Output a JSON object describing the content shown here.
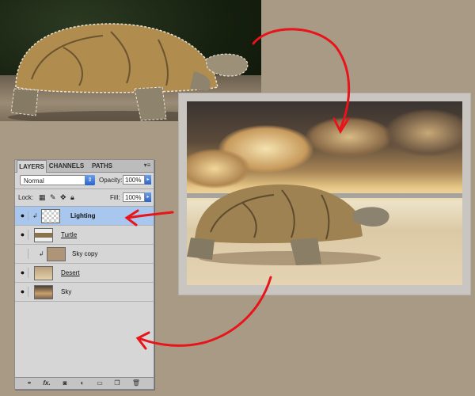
{
  "panel": {
    "tabs": [
      {
        "label": "LAYERS",
        "active": true
      },
      {
        "label": "CHANNELS",
        "active": false
      },
      {
        "label": "PATHS",
        "active": false
      }
    ],
    "menu_icon": "panel-menu-icon",
    "blend_mode": "Normal",
    "opacity_label": "Opacity:",
    "opacity_value": "100%",
    "lock_label": "Lock:",
    "fill_label": "Fill:",
    "fill_value": "100%",
    "layers": [
      {
        "name": "Lighting",
        "visible": true,
        "clipped": true,
        "selected": true,
        "thumb": "transparent"
      },
      {
        "name": "Turtle",
        "visible": true,
        "clipped": false,
        "selected": false,
        "thumb": "turtle"
      },
      {
        "name": "Sky copy",
        "visible": false,
        "clipped": true,
        "selected": false,
        "thumb": "sky-copy"
      },
      {
        "name": "Desert",
        "visible": true,
        "clipped": false,
        "selected": false,
        "thumb": "desert"
      },
      {
        "name": "Sky",
        "visible": true,
        "clipped": false,
        "selected": false,
        "thumb": "sky"
      }
    ],
    "footer_icons": [
      "link-layers-icon",
      "fx-icon",
      "mask-icon",
      "adjustment-icon",
      "group-icon",
      "new-layer-icon",
      "trash-icon"
    ],
    "fx_label": "fx."
  },
  "colors": {
    "background": "#a89a85",
    "arrow": "#e8141a",
    "selection": "#a9c6ef"
  }
}
